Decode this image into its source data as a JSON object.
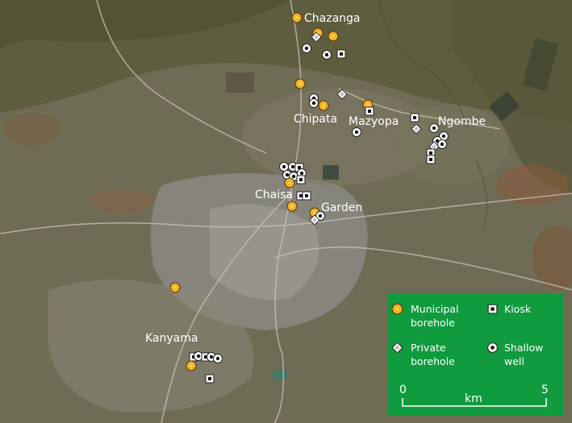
{
  "places": {
    "chazanga": "Chazanga",
    "chipata": "Chipata",
    "mazyopa": "Mazyopa",
    "ngombe": "Ngombe",
    "chaisa": "Chaisa",
    "garden": "Garden",
    "kanyama": "Kanyama"
  },
  "legend": {
    "municipal_l1": "Municipal",
    "municipal_l2": "borehole",
    "kiosk": "Kiosk",
    "private_l1": "Private",
    "private_l2": "borehole",
    "shallow_l1": "Shallow",
    "shallow_l2": "well",
    "background_color": "#0f9b3e"
  },
  "scale": {
    "start": "0",
    "unit": "km",
    "end": "5"
  },
  "symbol_icons": {
    "municipal_borehole": "sun-icon",
    "private_borehole": "diamond-icon",
    "kiosk": "square-dot-icon",
    "shallow_well": "ring-dot-icon"
  }
}
